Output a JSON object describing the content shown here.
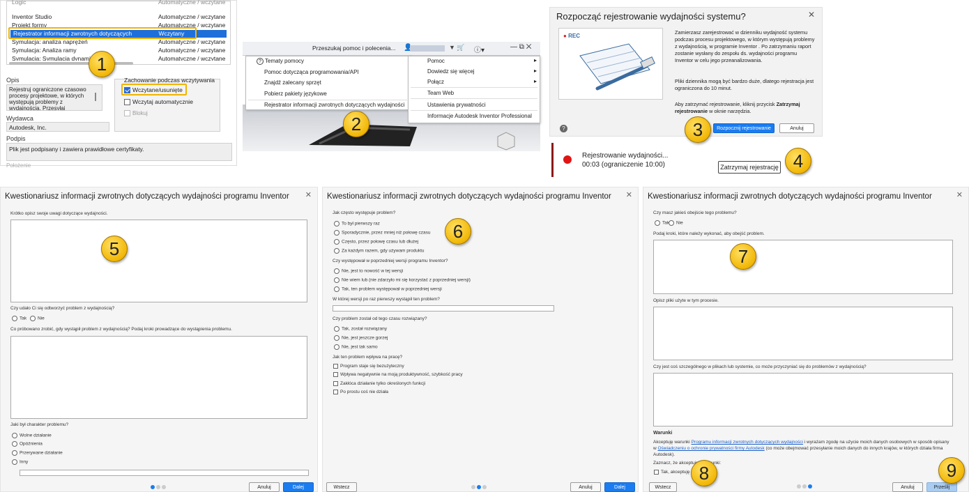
{
  "panel1": {
    "rows": [
      {
        "name": "Inventor Studio",
        "status": "Automatyczne / wczytane"
      },
      {
        "name": "Projekt formy",
        "status": "Automatyczne / wczytane"
      },
      {
        "name": "Rejestrator informacji zwrotnych dotyczących wydajności",
        "status": "Wczytany"
      },
      {
        "name": "Symulacja: analiza naprężeń",
        "status": "Automatyczne / wczytane"
      },
      {
        "name": "Symulacja: Analiza ramy",
        "status": "Automatyczne / wczytane"
      },
      {
        "name": "Symulacja: Symulacja dynamiczna",
        "status": "Automatyczne / wczytane"
      }
    ],
    "opis_label": "Opis",
    "opis_text": "Rejestruj ograniczone czasowo procesy projektowe, w których występują problemy z wydajnością. Przesyłaj",
    "behavior_label": "Zachowanie podczas wczytywania",
    "opt_loaded": "Wczytane/usunięte",
    "opt_auto": "Wczytaj automatycznie",
    "opt_block": "Blokuj",
    "publisher_label": "Wydawca",
    "publisher_value": "Autodesk, Inc.",
    "signature_label": "Podpis",
    "signature_value": "Plik jest podpisany i zawiera prawidłowe certyfikaty.",
    "footer_label": "Położenie"
  },
  "panel2": {
    "search_placeholder": "Przeszukaj pomoc i polecenia...",
    "help_menu": [
      "Tematy pomocy",
      "Pomoc dotycząca programowania/API",
      "Znajdź zalecany sprzęt",
      "Pobierz pakiety językowe",
      "Rejestrator informacji zwrotnych dotyczących wydajności"
    ],
    "sub_menu": [
      "Pomoc",
      "Dowiedz się więcej",
      "Połącz",
      "Team Web",
      "Ustawienia prywatności",
      "Informacje Autodesk Inventor Professional"
    ]
  },
  "panel3": {
    "title": "Rozpocząć rejestrowanie wydajności systemu?",
    "rec_label": "REC",
    "text1": "Zamierzasz zarejestrować w dzienniku wydajność systemu podczas procesu projektowego, w którym występują problemy z wydajnością, w programie Inventor . Po zatrzymaniu raport zostanie wysłany do zespołu ds. wydajności programu Inventor w celu jego przeanalizowania.",
    "text2": "Pliki dziennika mogą być bardzo duże, dlatego rejestracja jest ograniczona do 10 minut.",
    "text3a": "Aby zatrzymać rejestrowanie, kliknij przycisk ",
    "text3b": "Zatrzymaj rejestrowanie",
    "text3c": " w oknie narzędzia.",
    "start_btn": "Rozpocznij rejestrowanie",
    "cancel_btn": "Anuluj"
  },
  "panel4": {
    "status": "Rejestrowanie wydajności...",
    "time": "00:03 (ograniczenie 10:00)",
    "stop_btn": "Zatrzymaj rejestrację"
  },
  "q_title": "Kwestionariusz informacji zwrotnych dotyczących wydajności programu Inventor",
  "q1": {
    "prompt": "Krótko opisz swoje uwagi dotyczące wydajności.",
    "reproduce": "Czy udało Ci się odtworzyć problem z wydajnością?",
    "yes": "Tak",
    "no": "Nie",
    "tried": "Co próbowano zrobić, gdy wystąpił problem z wydajnością? Podaj kroki prowadzące do wystąpienia problemu.",
    "nature": "Jaki był charakter problemu?",
    "options": [
      "Wolne działanie",
      "Opóźnienia",
      "Przerywane działanie",
      "Inny"
    ],
    "cancel": "Anuluj",
    "next": "Dalej"
  },
  "q2": {
    "freq": "Jak często występuje problem?",
    "freq_opts": [
      "To był pierwszy raz",
      "Sporadycznie, przez mniej niż połowę czasu",
      "Często, przez połowę czasu lub dłużej",
      "Za każdym razem, gdy używam produktu"
    ],
    "prev": "Czy występował w poprzedniej wersji programu Inventor?",
    "prev_opts": [
      "Nie, jest to nowość w tej wersji",
      "Nie wiem lub (nie zdarzyło mi się korzystać z poprzedniej wersji)",
      "Tak, ten problem występował w poprzedniej wersji"
    ],
    "first_ver": "W której wersji po raz pierwszy wystąpił ten problem?",
    "resolved": "Czy problem został od tego czasu rozwiązany?",
    "resolved_opts": [
      "Tak, został rozwiązany",
      "Nie, jest jeszcze gorzej",
      "Nie, jest tak samo"
    ],
    "impact": "Jak ten problem wpływa na pracę?",
    "impact_opts": [
      "Program staje się bezużyteczny",
      "Wpływa negatywnie na moją produktywność, szybkość pracy",
      "Zakłóca działanie tylko określonych funkcji",
      "Po prostu coś nie działa"
    ],
    "back": "Wstecz",
    "cancel": "Anuluj",
    "next": "Dalej"
  },
  "q3": {
    "workaround": "Czy masz jakieś obejście tego problemu?",
    "yes": "Tak",
    "no": "Nie",
    "steps": "Podaj kroki, które należy wykonać, aby obejść problem.",
    "files": "Opisz pliki użyte w tym procesie.",
    "special": "Czy jest coś szczególnego w plikach lub systemie, co może przyczyniać się do problemów z wydajnością?",
    "terms_title": "Warunki",
    "terms_a": "Akceptuję warunki ",
    "terms_link1": "Programu informacji zwrotnych dotyczących wydajności",
    "terms_b": " i wyrażam zgodę na użycie moich danych osobowych w sposób opisany w ",
    "terms_link2": "Oświadczeniu o ochronie prywatności firmy Autodesk",
    "terms_c": " (co może obejmować przesyłanie moich danych do innych krajów, w których działa firma Autodesk).",
    "mark": "Zaznacz, że akceptujesz warunki:",
    "accept": "Tak, akceptuję",
    "back": "Wstecz",
    "cancel": "Anuluj",
    "send": "Prześlij"
  },
  "callouts": [
    "1",
    "2",
    "3",
    "4",
    "5",
    "6",
    "7",
    "8",
    "9"
  ],
  "colors": {
    "accent": "#1a7cf0",
    "callout": "#f2b705",
    "highlight": "#f0b400",
    "selected_row": "#1e6fd9"
  }
}
